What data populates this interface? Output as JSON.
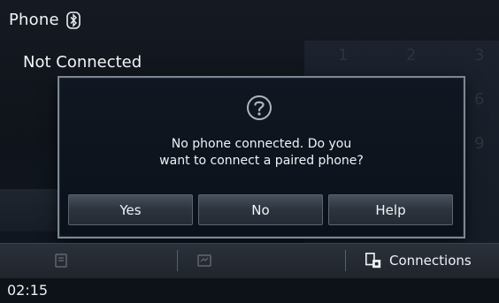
{
  "header": {
    "title": "Phone",
    "status": "Not Connected"
  },
  "keypad": {
    "keys": [
      "1",
      "2",
      "3",
      "6",
      "9"
    ]
  },
  "dialog": {
    "line1": "No phone connected. Do you",
    "line2": "want to connect a paired phone?",
    "buttons": {
      "yes": "Yes",
      "no": "No",
      "help": "Help"
    }
  },
  "bottom_bar": {
    "connections_label": "Connections"
  },
  "clock": {
    "time": "02:15"
  },
  "icons": {
    "bluetooth": "bluetooth-icon",
    "question": "question-icon",
    "connections": "connections-icon"
  }
}
